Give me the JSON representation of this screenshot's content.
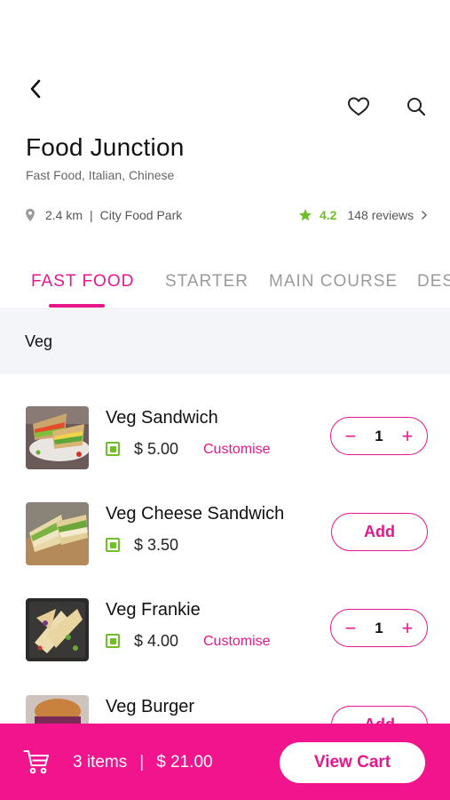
{
  "header": {
    "restaurant_name": "Food Junction",
    "cuisines": "Fast Food, Italian, Chinese",
    "distance": "2.4 km",
    "separator": "|",
    "location": "City Food Park",
    "rating": "4.2",
    "reviews": "148 reviews"
  },
  "tabs": [
    {
      "label": "FAST FOOD",
      "active": true
    },
    {
      "label": "STARTER",
      "active": false
    },
    {
      "label": "MAIN COURSE",
      "active": false
    },
    {
      "label": "DESSERTS",
      "active": false
    }
  ],
  "section": {
    "label": "Veg"
  },
  "items": [
    {
      "name": "Veg Sandwich",
      "price": "$ 5.00",
      "customise": "Customise",
      "qty": "1"
    },
    {
      "name": "Veg Cheese Sandwich",
      "price": "$ 3.50",
      "add_label": "Add"
    },
    {
      "name": "Veg Frankie",
      "price": "$ 4.00",
      "customise": "Customise",
      "qty": "1"
    },
    {
      "name": "Veg Burger",
      "add_label": "Add"
    }
  ],
  "stepper": {
    "minus": "−",
    "plus": "+"
  },
  "cart": {
    "items_count": "3 items",
    "separator": "|",
    "total": "$ 21.00",
    "view_cart_label": "View Cart"
  },
  "colors": {
    "accent": "#e8168c",
    "cart_bar": "#f2148c",
    "veg_green": "#6fbf29",
    "section_bg": "#f4f5f8"
  },
  "icons": [
    "back-arrow-icon",
    "heart-icon",
    "search-icon",
    "location-pin-icon",
    "star-icon",
    "chevron-right-icon",
    "veg-indicator-icon",
    "cart-icon"
  ]
}
